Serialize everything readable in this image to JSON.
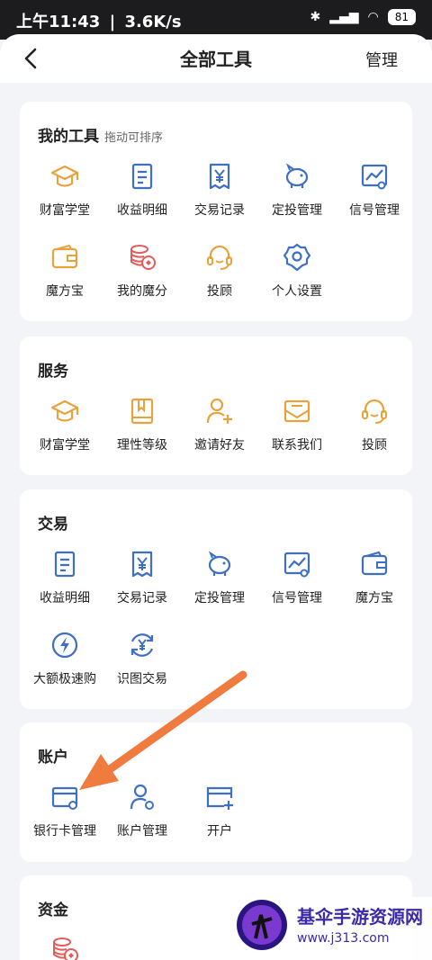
{
  "status_bar": {
    "time": "上午11:43",
    "speed": "3.6K/s",
    "battery": "81"
  },
  "header": {
    "title": "全部工具",
    "manage_label": "管理"
  },
  "sections": [
    {
      "title": "我的工具",
      "subtitle": "拖动可排序",
      "items": [
        {
          "label": "财富学堂",
          "icon": "graduation-cap-icon"
        },
        {
          "label": "收益明细",
          "icon": "document-icon"
        },
        {
          "label": "交易记录",
          "icon": "yen-receipt-icon"
        },
        {
          "label": "定投管理",
          "icon": "piggy-bank-icon"
        },
        {
          "label": "信号管理",
          "icon": "chart-signal-icon"
        },
        {
          "label": "魔方宝",
          "icon": "wallet-icon"
        },
        {
          "label": "我的魔分",
          "icon": "coins-icon"
        },
        {
          "label": "投顾",
          "icon": "headset-icon"
        },
        {
          "label": "个人设置",
          "icon": "gear-icon"
        }
      ]
    },
    {
      "title": "服务",
      "items": [
        {
          "label": "财富学堂",
          "icon": "graduation-cap-icon"
        },
        {
          "label": "理性等级",
          "icon": "book-icon"
        },
        {
          "label": "邀请好友",
          "icon": "add-user-icon"
        },
        {
          "label": "联系我们",
          "icon": "mail-icon"
        },
        {
          "label": "投顾",
          "icon": "headset-icon"
        }
      ]
    },
    {
      "title": "交易",
      "items": [
        {
          "label": "收益明细",
          "icon": "document-icon"
        },
        {
          "label": "交易记录",
          "icon": "yen-receipt-icon"
        },
        {
          "label": "定投管理",
          "icon": "piggy-bank-icon"
        },
        {
          "label": "信号管理",
          "icon": "chart-signal-icon"
        },
        {
          "label": "魔方宝",
          "icon": "wallet-icon"
        },
        {
          "label": "大额极速购",
          "icon": "lightning-icon"
        },
        {
          "label": "识图交易",
          "icon": "yen-scan-icon"
        }
      ]
    },
    {
      "title": "账户",
      "items": [
        {
          "label": "银行卡管理",
          "icon": "bank-card-icon"
        },
        {
          "label": "账户管理",
          "icon": "user-gear-icon"
        },
        {
          "label": "开户",
          "icon": "card-plus-icon"
        }
      ]
    },
    {
      "title": "资金",
      "items": [
        {
          "label": "",
          "icon": "coins-icon"
        }
      ]
    }
  ],
  "watermark": {
    "title": "基伞手游资源网",
    "url": "www.j313.com"
  },
  "colors": {
    "orange": "#e9a23b",
    "blue": "#3e6fc3",
    "red": "#e45b5b",
    "arrow": "#f07b3f"
  }
}
